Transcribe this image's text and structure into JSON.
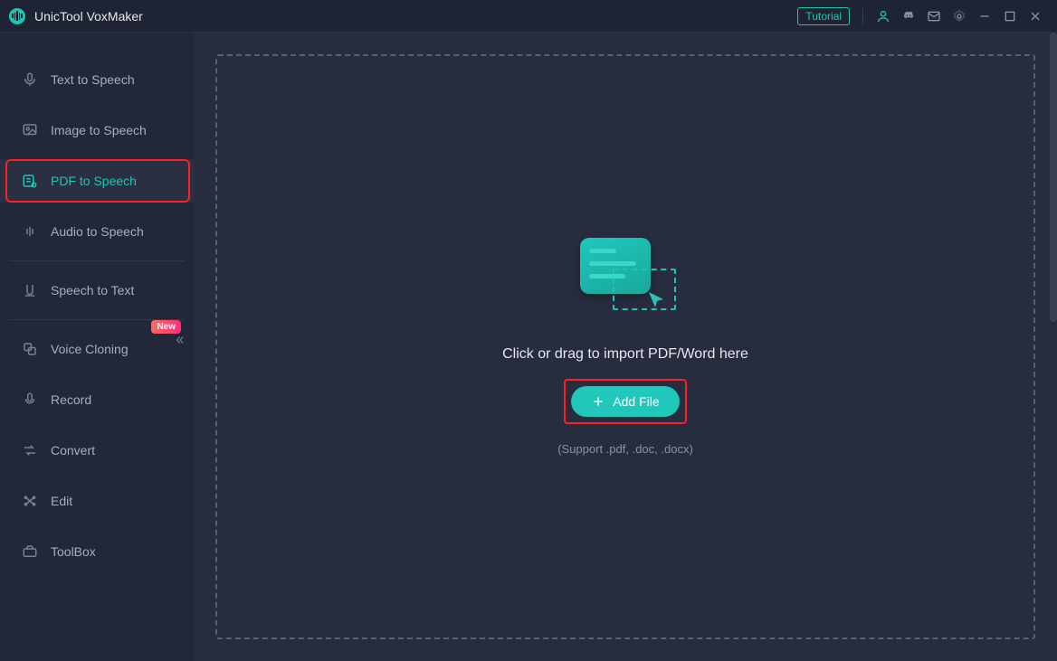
{
  "app": {
    "title": "UnicTool VoxMaker"
  },
  "titlebar": {
    "tutorial": "Tutorial"
  },
  "sidebar": {
    "items": [
      {
        "label": "Text to Speech"
      },
      {
        "label": "Image to Speech"
      },
      {
        "label": "PDF to Speech"
      },
      {
        "label": "Audio to Speech"
      },
      {
        "label": "Speech to Text"
      },
      {
        "label": "Voice Cloning"
      },
      {
        "label": "Record"
      },
      {
        "label": "Convert"
      },
      {
        "label": "Edit"
      },
      {
        "label": "ToolBox"
      }
    ],
    "new_badge": "New"
  },
  "main": {
    "drop_text": "Click or drag to import PDF/Word here",
    "addfile_label": "Add File",
    "support_text": "(Support .pdf, .doc, .docx)"
  }
}
